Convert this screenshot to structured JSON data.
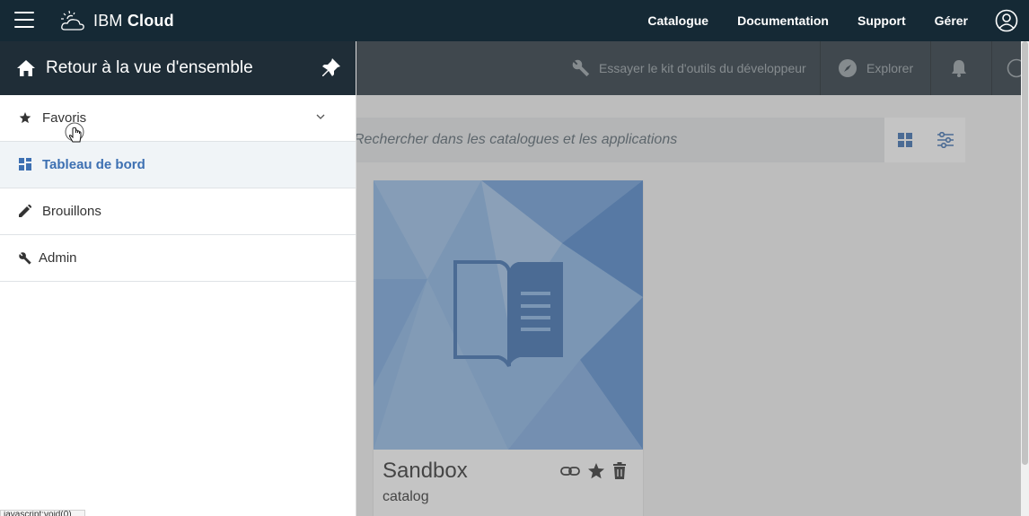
{
  "topbar": {
    "brand_prefix": "IBM",
    "brand_name": "Cloud",
    "nav": [
      "Catalogue",
      "Documentation",
      "Support",
      "Gérer"
    ]
  },
  "subbar": {
    "toolkit_label": "Essayer le kit d'outils du développeur",
    "explore_label": "Explorer"
  },
  "search": {
    "placeholder": "Rechercher dans les catalogues et les applications"
  },
  "card": {
    "title": "Sandbox",
    "subtitle": "catalog"
  },
  "panel": {
    "header_title": "Retour à la vue d'ensemble",
    "items": [
      {
        "label": "Favoris",
        "icon": "star-icon"
      },
      {
        "label": "Tableau de bord",
        "icon": "dashboard-icon"
      },
      {
        "label": "Brouillons",
        "icon": "pencil-icon"
      },
      {
        "label": "Admin",
        "icon": "wrench-icon"
      }
    ]
  },
  "statusbar": {
    "text": "javascript:void(0)"
  },
  "colors": {
    "topbar": "#152935",
    "panel_header": "#1f2d37",
    "active_text": "#3d70b2",
    "card_image": "#8ab5e6"
  }
}
